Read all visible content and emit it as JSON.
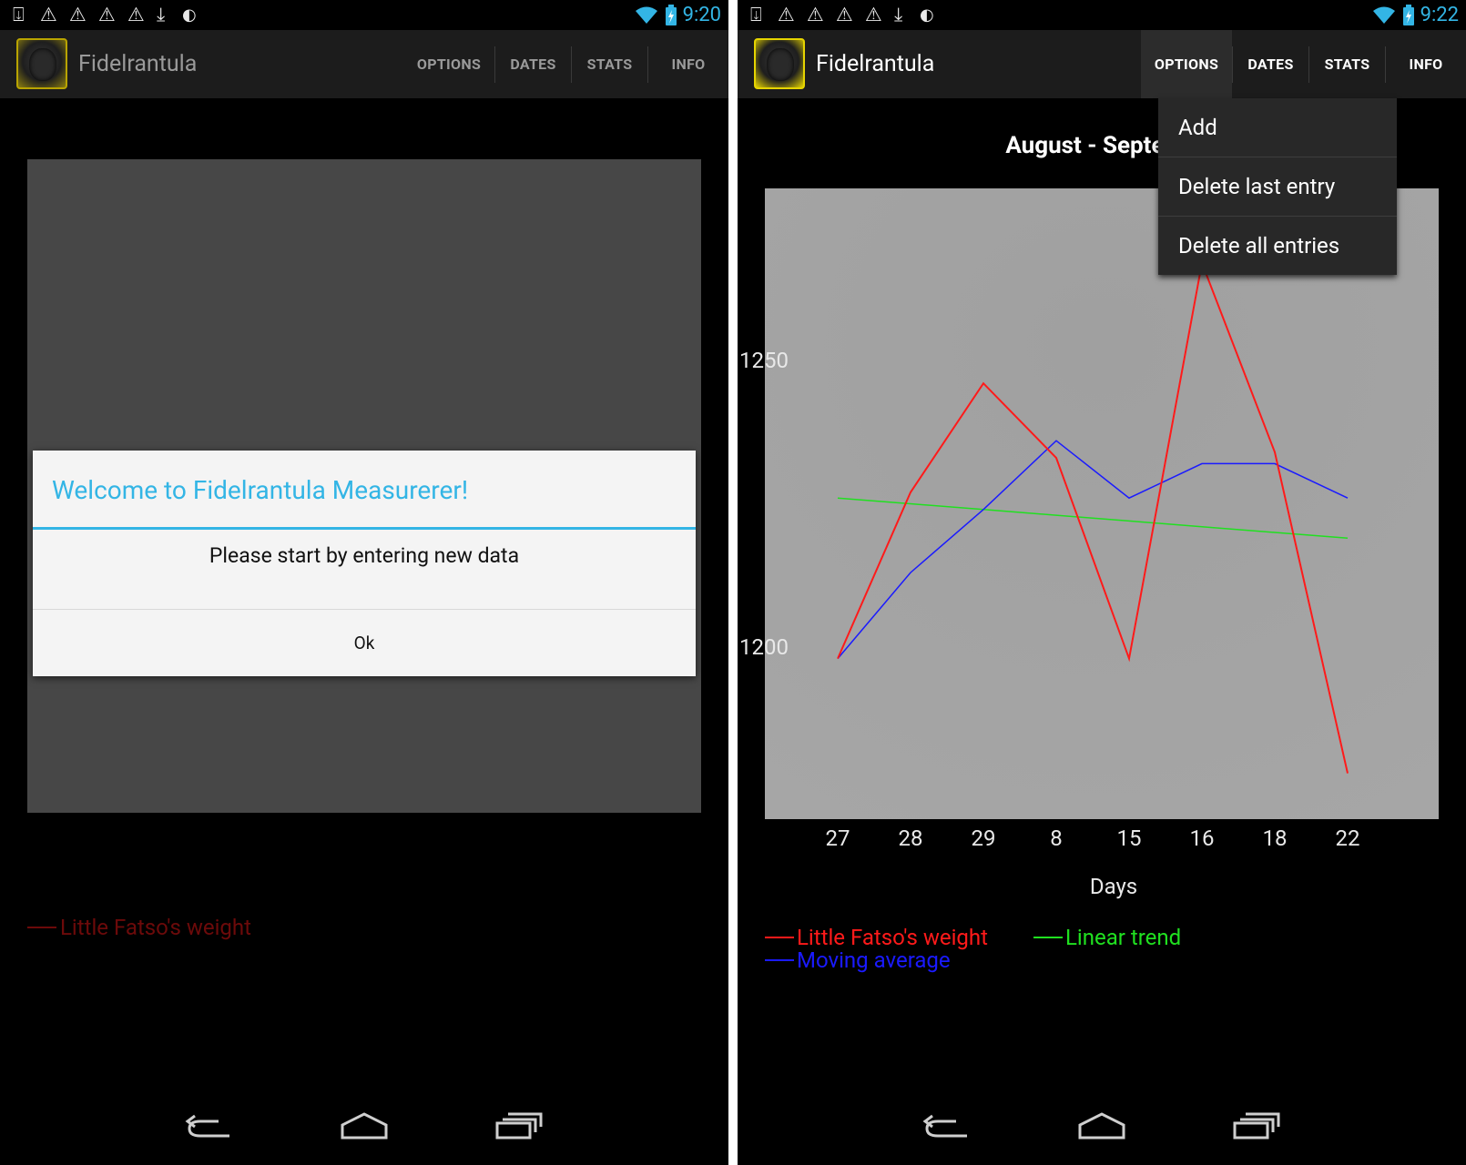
{
  "left": {
    "status": {
      "time": "9:20"
    },
    "actionbar": {
      "title": "Fidelrantula",
      "tabs": [
        "OPTIONS",
        "DATES",
        "STATS",
        "INFO"
      ]
    },
    "dialog": {
      "title": "Welcome to Fidelrantula Measurerer!",
      "message": "Please start by entering new data",
      "ok_label": "Ok"
    },
    "legend": {
      "label": "Little Fatso's weight",
      "color": "#6c0a0a"
    }
  },
  "right": {
    "status": {
      "time": "9:22"
    },
    "actionbar": {
      "title": "Fidelrantula",
      "tabs": [
        "OPTIONS",
        "DATES",
        "STATS",
        "INFO"
      ]
    },
    "menu": {
      "items": [
        "Add",
        "Delete last entry",
        "Delete all entries"
      ]
    },
    "chart_data": {
      "type": "line",
      "title": "August - Septemb",
      "xlabel": "Days",
      "categories": [
        "27",
        "28",
        "29",
        "8",
        "15",
        "16",
        "18",
        "22"
      ],
      "yticks": [
        "1250",
        "1200"
      ],
      "ylim": [
        1170,
        1280
      ],
      "series": [
        {
          "name": "Little Fatso's weight",
          "color": "#ff1a1a",
          "values": [
            1198,
            1227,
            1246,
            1233,
            1198,
            1267,
            1234,
            1178
          ]
        },
        {
          "name": "Moving average",
          "color": "#1a1aff",
          "values": [
            1198,
            1213,
            1224,
            1236,
            1226,
            1232,
            1232,
            1226
          ]
        },
        {
          "name": "Linear trend",
          "color": "#20e020",
          "values": [
            1226,
            1225,
            1224,
            1223,
            1222,
            1221,
            1220,
            1219
          ]
        }
      ]
    }
  },
  "icons": {
    "status_left": [
      "download-done-icon",
      "warning-icon",
      "warning-icon",
      "warning-icon",
      "warning-icon",
      "download-icon",
      "android-icon"
    ],
    "status_right": [
      "wifi-icon",
      "battery-icon"
    ],
    "nav": [
      "back-icon",
      "home-icon",
      "recent-apps-icon"
    ]
  }
}
